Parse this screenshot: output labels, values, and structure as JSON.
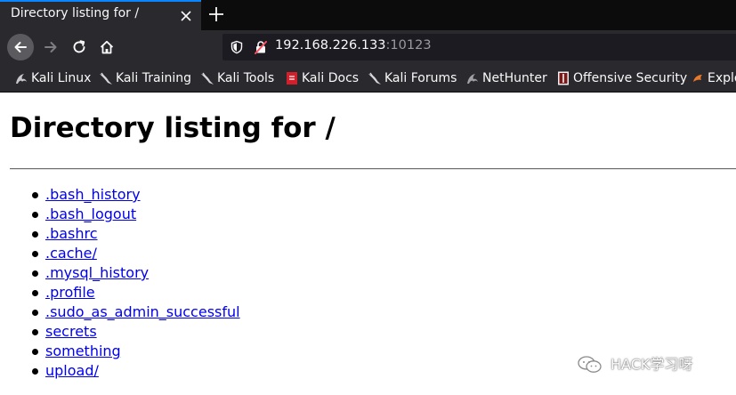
{
  "tab": {
    "title": "Directory listing for /"
  },
  "urlbar": {
    "host": "192.168.226.133",
    "port": ":10123"
  },
  "bookmarks": [
    {
      "label": "Kali Linux",
      "icon": "kali-dragon-icon"
    },
    {
      "label": "Kali Training",
      "icon": "kali-dragon-icon"
    },
    {
      "label": "Kali Tools",
      "icon": "kali-dragon-icon"
    },
    {
      "label": "Kali Docs",
      "icon": "kali-docs-icon"
    },
    {
      "label": "Kali Forums",
      "icon": "kali-dragon-icon"
    },
    {
      "label": "NetHunter",
      "icon": "nethunter-icon"
    },
    {
      "label": "Offensive Security",
      "icon": "offsec-icon"
    },
    {
      "label": "Exploit",
      "icon": "exploit-db-icon"
    }
  ],
  "page": {
    "heading": "Directory listing for /",
    "entries": [
      ".bash_history",
      ".bash_logout",
      ".bashrc",
      ".cache/",
      ".mysql_history",
      ".profile",
      ".sudo_as_admin_successful",
      "secrets",
      "something",
      "upload/"
    ]
  },
  "watermark": {
    "text": "HACK学习呀"
  },
  "colors": {
    "tab_accent": "#0a84ff",
    "chrome_bg": "#2a2a2e",
    "link": "#0000ee"
  }
}
